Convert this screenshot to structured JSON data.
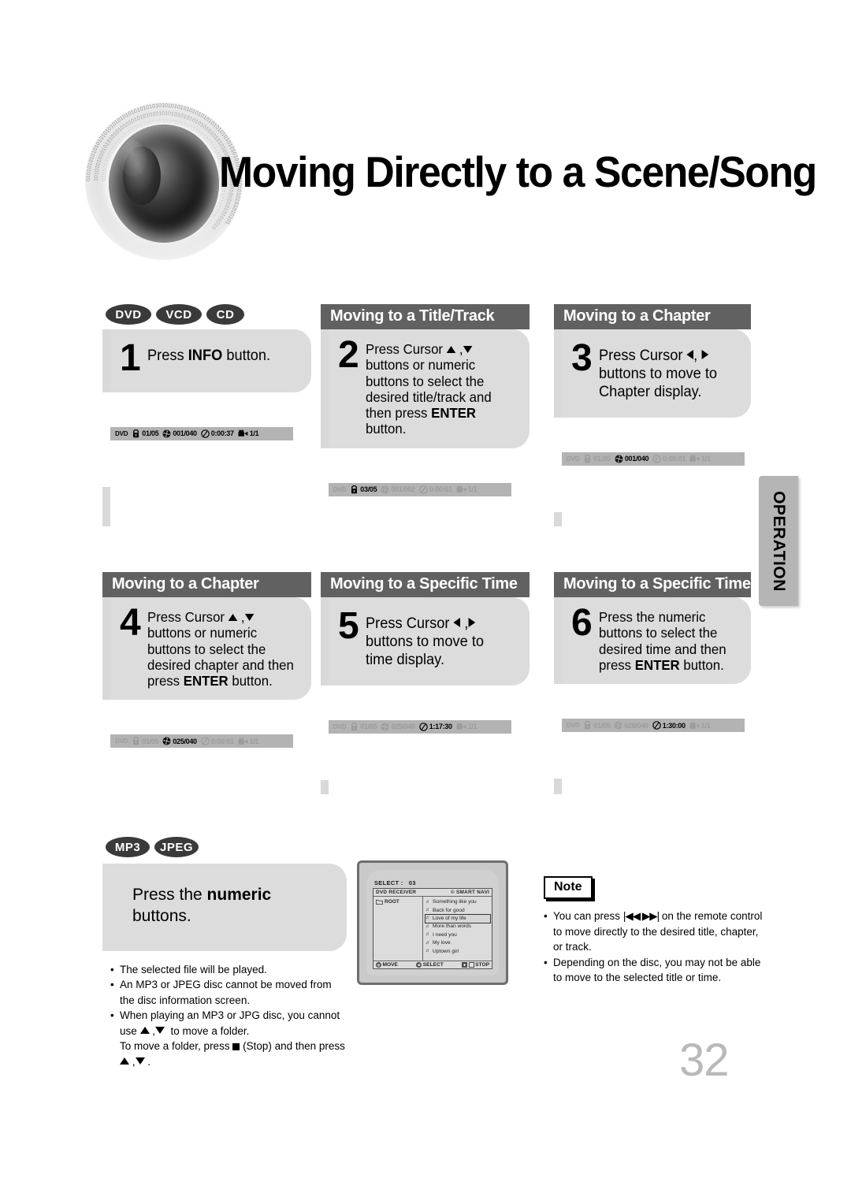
{
  "page": {
    "title": "Moving Directly to a Scene/Song",
    "number": "32",
    "side_tab": "OPERATION"
  },
  "disc_badges_top": [
    "DVD",
    "VCD",
    "CD"
  ],
  "disc_badges_bottom": [
    "MP3",
    "JPEG"
  ],
  "columns": [
    {
      "header": "",
      "step_number": "1",
      "step_text_html": "Press <b>INFO</b> button.",
      "step_size": "big",
      "osd": {
        "label": "DVD",
        "title": "01/05",
        "chapter": "001/040",
        "time": "0:00:37",
        "angle": "1/1",
        "highlight": "none"
      }
    },
    {
      "header": "Moving to a Title/Track",
      "step_number": "2",
      "step_text_html": "Press Cursor <span class=\"tri-up\"></span> ,<span class=\"tri-dn\"></span> buttons or numeric buttons to select the desired title/track and then press <b>ENTER</b> button.",
      "step_size": "small",
      "osd": {
        "label": "DVD",
        "title": "03/05",
        "chapter": "001/002",
        "time": "0:00:01",
        "angle": "1/1",
        "highlight": "title"
      }
    },
    {
      "header": "Moving to a Chapter",
      "step_number": "3",
      "step_text_html": "Press Cursor <span class=\"tri-lt\"></span>, <span class=\"tri-rt\"></span> buttons to move to Chapter display.",
      "step_size": "big",
      "osd": {
        "label": "DVD",
        "title": "01:05",
        "chapter": "001/040",
        "time": "0:00:01",
        "angle": "1/1",
        "highlight": "chapter"
      }
    },
    {
      "header": "Moving to a Chapter",
      "step_number": "4",
      "step_text_html": "Press Cursor <span class=\"tri-up\"></span> ,<span class=\"tri-dn\"></span> buttons or numeric buttons to select the desired chapter and then press <b>ENTER</b> button.",
      "step_size": "small",
      "osd": {
        "label": "DVD",
        "title": "01/05",
        "chapter": "025/040",
        "time": "0:00:01",
        "angle": "1/1",
        "highlight": "chapter"
      }
    },
    {
      "header": "Moving to a Specific Time",
      "step_number": "5",
      "step_text_html": "Press Cursor <span class=\"tri-lt\"></span> ,<span class=\"tri-rt\"></span> buttons to move to time display.",
      "step_size": "big",
      "osd": {
        "label": "DVD",
        "title": "01/05",
        "chapter": "025/040",
        "time": "1:17:30",
        "angle": "1/1",
        "highlight": "time"
      }
    },
    {
      "header": "Moving to a Specific Time",
      "step_number": "6",
      "step_text_html": "Press the numeric buttons to select the desired time and then press <b>ENTER</b> button.",
      "step_size": "small",
      "osd": {
        "label": "DVD",
        "title": "01/05",
        "chapter": "028/040",
        "time": "1:30:00",
        "angle": "1/1",
        "highlight": "time"
      }
    }
  ],
  "mp3_section": {
    "bubble_html": "Press the <b>numeric</b><br>buttons.",
    "bullets_html": [
      "The selected file will be played.",
      "An MP3 or JPEG disc cannot be moved from the disc information screen.",
      "When playing an MP3 or JPG disc, you cannot use <span class=\"tri-up\"></span> ,<span class=\"tri-dn\"></span>&nbsp; to move a folder.<br>To move a folder, press <span class=\"sq-stop\"></span> (Stop) and then press <span class=\"tri-up\"></span> ,<span class=\"tri-dn\"></span> ."
    ]
  },
  "tv_screen": {
    "select_label": "SELECT :",
    "select_value": "03",
    "title_left": "DVD RECEIVER",
    "title_right": "© SMART NAVI",
    "root_label": "ROOT",
    "files": [
      "Something like you",
      "Back for good",
      "Love of my life",
      "More than words",
      "I need you",
      "My love",
      "Uptown girl"
    ],
    "selected_index": 2,
    "footer": [
      {
        "key": "◎",
        "label": "MOVE",
        "type": "circle"
      },
      {
        "key": "⊜",
        "label": "SELECT",
        "type": "circle"
      },
      {
        "key": "▣",
        "label": "STOP",
        "type": "square-pair"
      }
    ]
  },
  "note": {
    "label": "Note",
    "bullets_html": [
      "You can press <span style=\"letter-spacing:-1px\">|◀◀ ▶▶|</span> on the remote control to move directly to the desired title, chapter, or track.",
      "Depending on the disc, you may not be able to move to the selected title or time."
    ]
  },
  "colors": {
    "header_bar": "#616161",
    "bubble": "#dcdcdc",
    "strip": "#d9d9d9",
    "osd_bar": "#b3b3b3",
    "tab": "#b5b5b5",
    "page_number": "#b9b9b9"
  }
}
